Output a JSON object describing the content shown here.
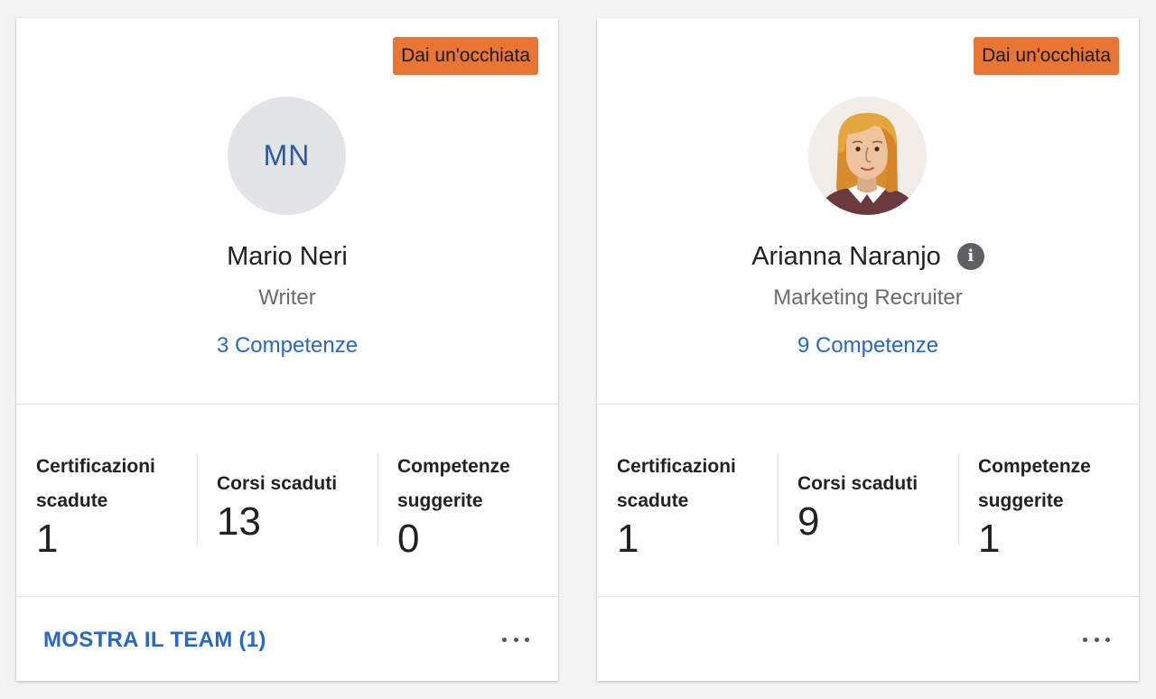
{
  "colors": {
    "badge_bg": "#e87534",
    "link": "#2767c9",
    "initials_text": "#2b5ba6"
  },
  "cards": [
    {
      "badge": "Dai un'occhiata",
      "avatar_initials": "MN",
      "name": "Mario Neri",
      "role": "Writer",
      "skills_link": "3 Competenze",
      "stats": [
        {
          "label": "Certificazioni scadute",
          "value": "1"
        },
        {
          "label": "Corsi scaduti",
          "value": "13"
        },
        {
          "label": "Competenze suggerite",
          "value": "0"
        }
      ],
      "team_link": "MOSTRA IL TEAM (1)",
      "more_icon": "more-horizontal-icon"
    },
    {
      "badge": "Dai un'occhiata",
      "avatar_icon": "user-photo-avatar",
      "name": "Arianna Naranjo",
      "info_icon": "i",
      "role": "Marketing Recruiter",
      "skills_link": "9 Competenze",
      "stats": [
        {
          "label": "Certificazioni scadute",
          "value": "1"
        },
        {
          "label": "Corsi scaduti",
          "value": "9"
        },
        {
          "label": "Competenze suggerite",
          "value": "1"
        }
      ],
      "more_icon": "more-horizontal-icon"
    }
  ]
}
